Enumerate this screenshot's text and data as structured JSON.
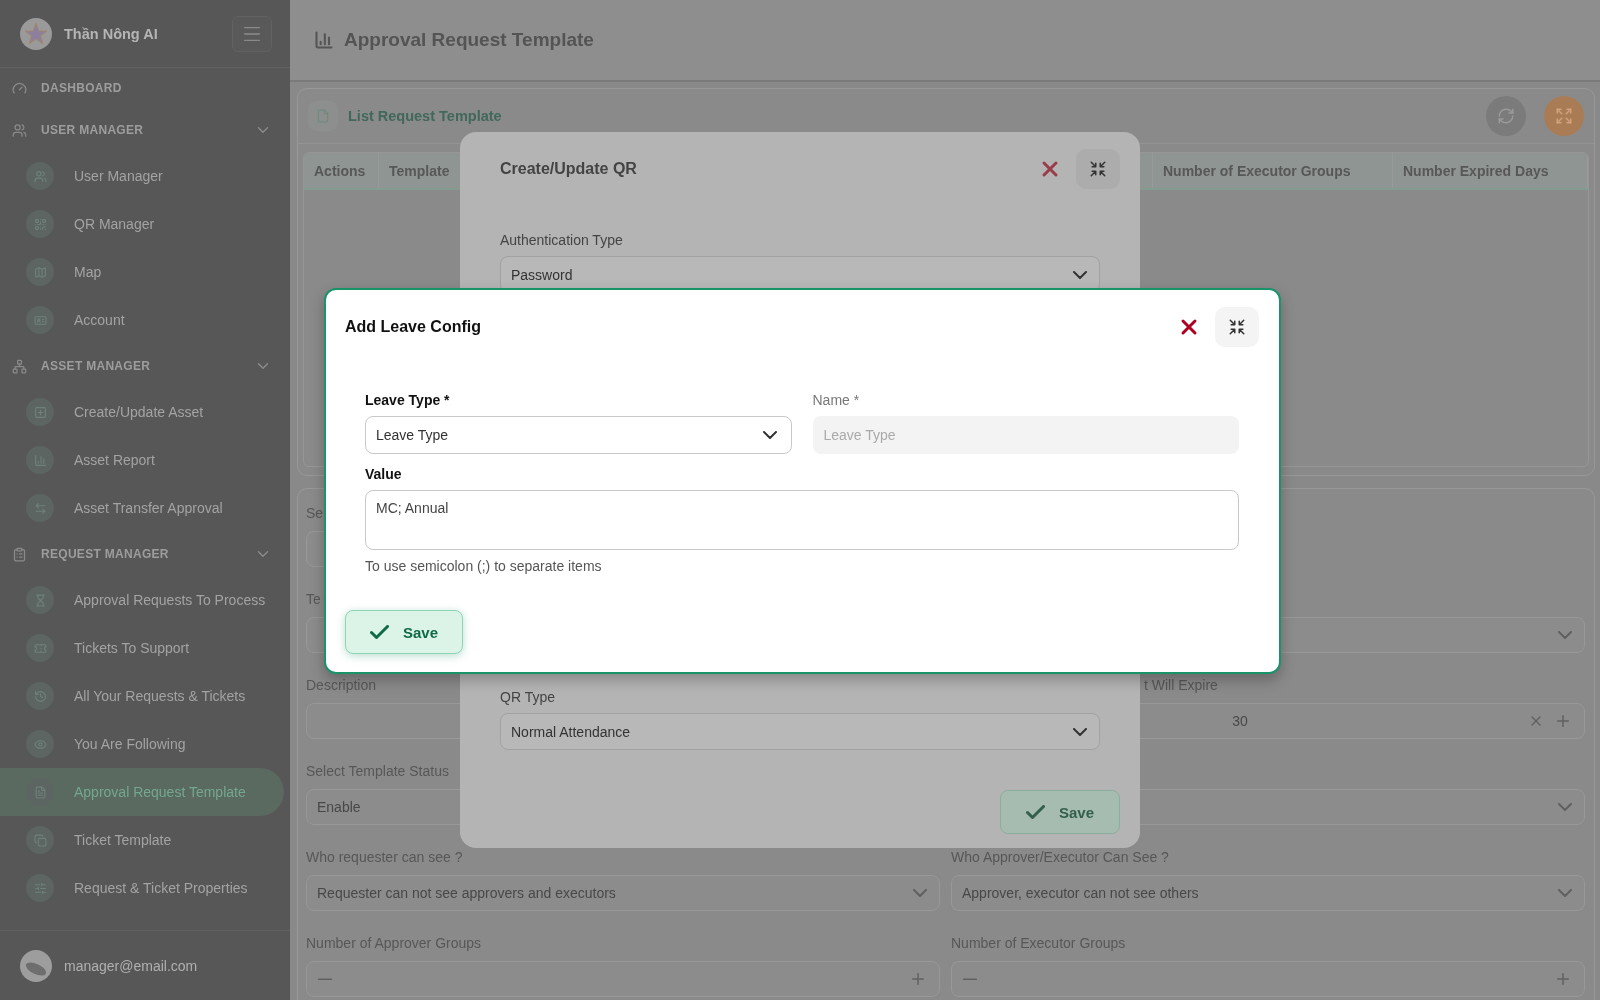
{
  "sidebar": {
    "brand": "Thần Nông AI",
    "sections": [
      {
        "kind": "link",
        "label": "DASHBOARD"
      },
      {
        "kind": "group",
        "label": "USER MANAGER",
        "expanded": true,
        "items": [
          {
            "label": "User Manager",
            "selected": false
          },
          {
            "label": "QR Manager",
            "selected": false
          },
          {
            "label": "Map",
            "selected": false
          },
          {
            "label": "Account",
            "selected": false
          }
        ]
      },
      {
        "kind": "group",
        "label": "ASSET MANAGER",
        "expanded": true,
        "items": [
          {
            "label": "Create/Update Asset",
            "selected": false
          },
          {
            "label": "Asset Report",
            "selected": false
          },
          {
            "label": "Asset Transfer Approval",
            "selected": false
          }
        ]
      },
      {
        "kind": "group",
        "label": "REQUEST MANAGER",
        "expanded": true,
        "items": [
          {
            "label": "Approval Requests To Process",
            "selected": false
          },
          {
            "label": "Tickets To Support",
            "selected": false
          },
          {
            "label": "All Your Requests & Tickets",
            "selected": false
          },
          {
            "label": "You Are Following",
            "selected": false
          },
          {
            "label": "Approval Request Template",
            "selected": true
          },
          {
            "label": "Ticket Template",
            "selected": false
          },
          {
            "label": "Request & Ticket Properties",
            "selected": false
          }
        ]
      }
    ],
    "user": "manager@email.com"
  },
  "header": {
    "title": "Approval Request Template"
  },
  "list_card": {
    "title": "List Request Template",
    "columns": [
      "Actions",
      "Template",
      "Number of Executor Groups",
      "Number Expired Days"
    ]
  },
  "form": {
    "rows": [
      {
        "left": {
          "kind": "text",
          "label": "Se"
        }
      },
      {
        "left": {
          "kind": "text",
          "label": "Te"
        },
        "right": {
          "kind": "select"
        }
      },
      {
        "left": {
          "kind": "text",
          "label": "Description"
        },
        "right": {
          "kind": "number",
          "label": "t Will Expire",
          "value": "30"
        }
      },
      {
        "left": {
          "kind": "text",
          "label": "Select Template Status",
          "value": "Enable"
        },
        "right": {
          "kind": "select"
        }
      },
      {
        "left": {
          "kind": "select",
          "label": "Who requester can see ?",
          "value": "Requester can not see approvers and executors"
        },
        "right": {
          "kind": "select",
          "label": "Who Approver/Executor Can See ?",
          "value": "Approver, executor can not see others"
        }
      },
      {
        "left": {
          "kind": "stepper",
          "label": "Number of Approver Groups"
        },
        "right": {
          "kind": "stepper",
          "label": "Number of Executor Groups"
        }
      }
    ]
  },
  "qr_dialog": {
    "title": "Create/Update QR",
    "fields": [
      {
        "label": "Authentication Type",
        "value": "Password"
      },
      {
        "label": "QR Type",
        "value": "Normal Attendance"
      }
    ],
    "save": "Save"
  },
  "leave_dialog": {
    "title": "Add Leave Config",
    "leave_type": {
      "label": "Leave Type *",
      "value": "Leave Type"
    },
    "name": {
      "label": "Name *",
      "placeholder": "Leave Type",
      "disabled": true
    },
    "value": {
      "label": "Value",
      "value": "MC; Annual",
      "hint": "To use semicolon (;) to separate items"
    },
    "save": "Save"
  }
}
